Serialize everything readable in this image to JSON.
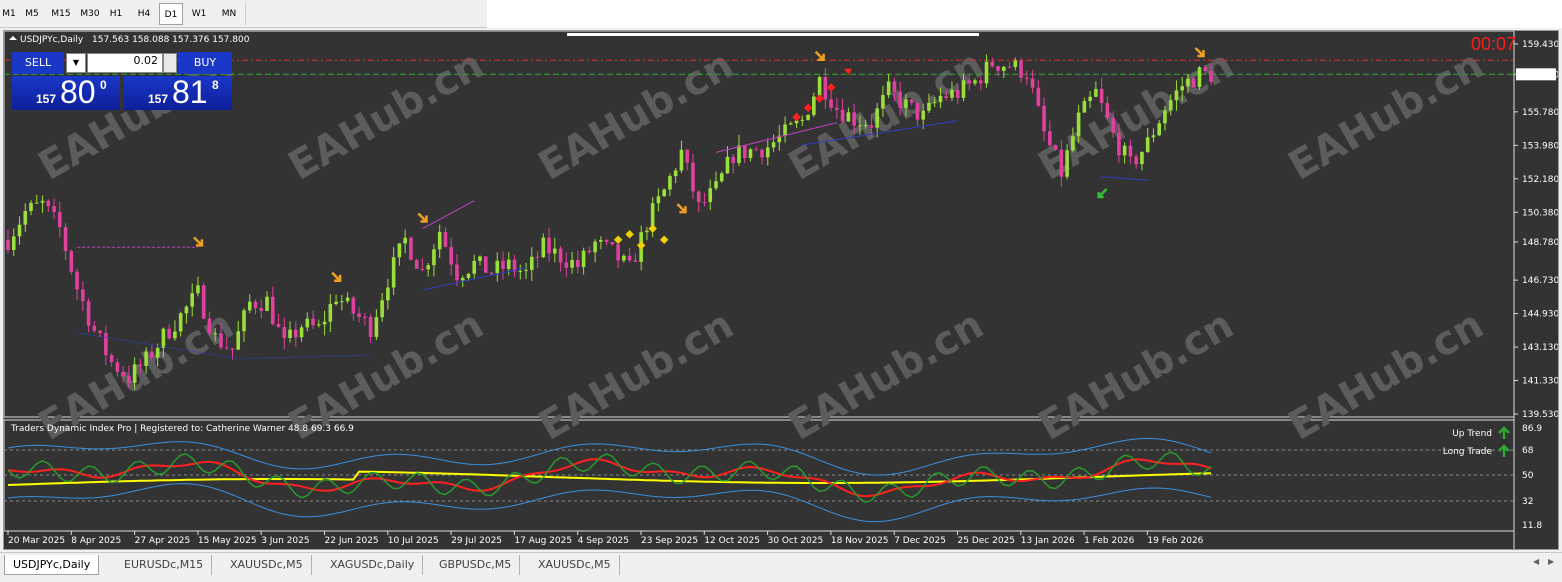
{
  "timeframes": [
    "M1",
    "M5",
    "M15",
    "M30",
    "H1",
    "H4",
    "D1",
    "W1",
    "MN"
  ],
  "active_timeframe": "D1",
  "chart": {
    "symbol_header": "USDJPYc,Daily",
    "ohlc": "157.563 158.088 157.376 157.800",
    "countdown": "00:07",
    "current_price_label": "157.800",
    "watermark": "EAHub.cn",
    "colors": {
      "background": "#333333",
      "bull": "#9be03a",
      "bear": "#e0409e",
      "ask_line": "#e03030",
      "bid_line": "#2fa82f"
    }
  },
  "trade_panel": {
    "sell_label": "SELL",
    "buy_label": "BUY",
    "lot_value": "0.02",
    "sell_price": {
      "prefix": "157",
      "big": "80",
      "sup": "0"
    },
    "buy_price": {
      "prefix": "157",
      "big": "81",
      "sup": "8"
    }
  },
  "indicator": {
    "title": "Traders Dynamic Index Pro | Registered to: Catherine Warner 48.8 69.3 66.9",
    "legend": [
      "Up Trend",
      "Long Trade"
    ],
    "levels": [
      "86.9",
      "68",
      "50",
      "32",
      "11.8"
    ]
  },
  "chart_data": {
    "type": "candlestick",
    "x_label_dates": [
      "20 Mar 2025",
      "8 Apr 2025",
      "27 Apr 2025",
      "15 May 2025",
      "3 Jun 2025",
      "22 Jun 2025",
      "10 Jul 2025",
      "29 Jul 2025",
      "17 Aug 2025",
      "4 Sep 2025",
      "23 Sep 2025",
      "12 Oct 2025",
      "30 Oct 2025",
      "18 Nov 2025",
      "7 Dec 2025",
      "25 Dec 2025",
      "13 Jan 2026",
      "1 Feb 2026",
      "19 Feb 2026"
    ],
    "y_ticks": [
      "159.430",
      "157.800",
      "155.780",
      "153.980",
      "152.180",
      "150.380",
      "148.780",
      "146.730",
      "144.930",
      "143.130",
      "141.330",
      "139.530"
    ],
    "ylim": [
      139.53,
      159.43
    ],
    "close_path": [
      [
        0,
        148.9
      ],
      [
        3,
        150.4
      ],
      [
        6,
        150.8
      ],
      [
        9,
        149.5
      ],
      [
        12,
        146.3
      ],
      [
        15,
        144.0
      ],
      [
        18,
        142.3
      ],
      [
        21,
        141.5
      ],
      [
        24,
        142.4
      ],
      [
        27,
        143.7
      ],
      [
        30,
        144.8
      ],
      [
        33,
        146.0
      ],
      [
        36,
        143.6
      ],
      [
        39,
        143.0
      ],
      [
        42,
        145.5
      ],
      [
        45,
        145.6
      ],
      [
        48,
        143.2
      ],
      [
        51,
        144.3
      ],
      [
        54,
        144.1
      ],
      [
        57,
        145.9
      ],
      [
        60,
        145.0
      ],
      [
        63,
        144.2
      ],
      [
        66,
        146.8
      ],
      [
        69,
        148.9
      ],
      [
        72,
        147.2
      ],
      [
        75,
        149.4
      ],
      [
        78,
        147.1
      ],
      [
        81,
        147.6
      ],
      [
        84,
        147.2
      ],
      [
        87,
        147.5
      ],
      [
        90,
        147.1
      ],
      [
        93,
        148.5
      ],
      [
        96,
        148.0
      ],
      [
        99,
        147.5
      ],
      [
        102,
        148.7
      ],
      [
        105,
        148.2
      ],
      [
        108,
        147.3
      ],
      [
        111,
        149.8
      ],
      [
        114,
        151.5
      ],
      [
        117,
        153.6
      ],
      [
        120,
        150.6
      ],
      [
        123,
        151.6
      ],
      [
        126,
        153.5
      ],
      [
        129,
        153.7
      ],
      [
        132,
        153.9
      ],
      [
        135,
        154.6
      ],
      [
        138,
        155.3
      ],
      [
        141,
        157.5
      ],
      [
        144,
        156.0
      ],
      [
        147,
        155.4
      ],
      [
        150,
        155.2
      ],
      [
        153,
        156.9
      ],
      [
        156,
        156.1
      ],
      [
        159,
        155.5
      ],
      [
        162,
        156.6
      ],
      [
        165,
        156.8
      ],
      [
        168,
        157.4
      ],
      [
        171,
        158.4
      ],
      [
        174,
        158.3
      ],
      [
        177,
        157.9
      ],
      [
        180,
        154.6
      ],
      [
        183,
        152.5
      ],
      [
        186,
        155.4
      ],
      [
        189,
        156.8
      ],
      [
        192,
        154.5
      ],
      [
        195,
        152.9
      ],
      [
        198,
        154.1
      ],
      [
        201,
        156.0
      ],
      [
        204,
        157.2
      ],
      [
        207,
        157.8
      ]
    ],
    "num_bars": 210
  }
}
